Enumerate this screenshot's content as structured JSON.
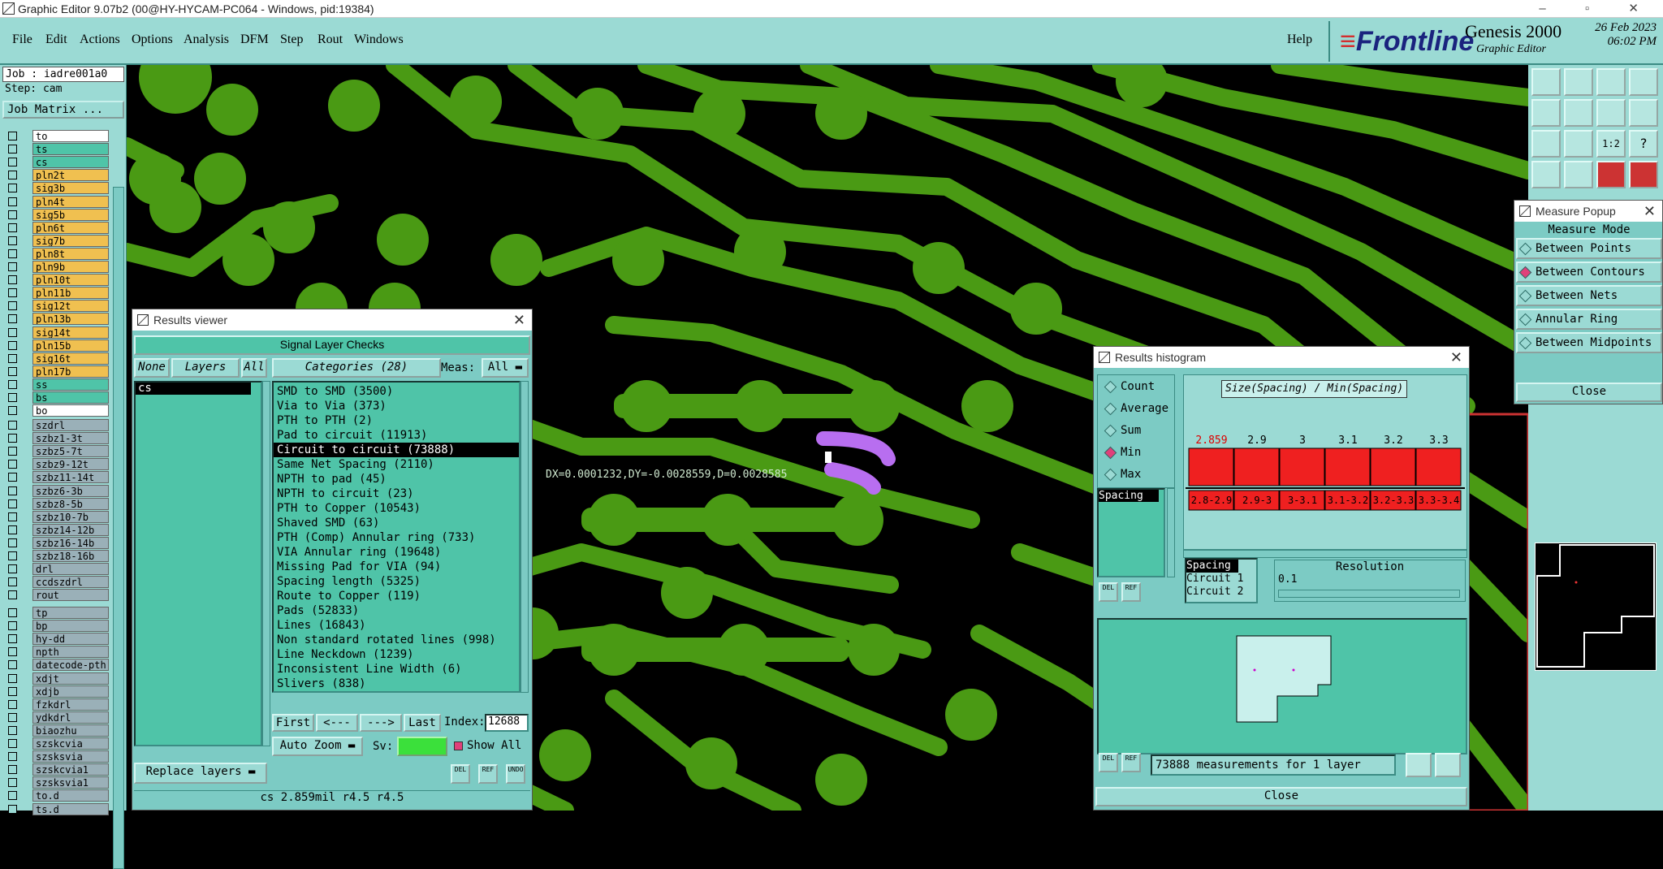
{
  "window": {
    "title": "Graphic Editor 9.07b2 (00@HY-HYCAM-PC064 - Windows, pid:19384)",
    "controls": "– ▫ ✕"
  },
  "menu": [
    "File",
    "Edit",
    "Actions",
    "Options",
    "Analysis",
    "DFM",
    "Step",
    "Rout",
    "Windows"
  ],
  "help": "Help",
  "brand": {
    "logo": "Frontline",
    "product": "Genesis 2000",
    "subtitle": "Graphic Editor",
    "date": "26 Feb 2023",
    "time": "06:02 PM"
  },
  "job": {
    "job_label": "Job : iadre001a0",
    "step_label": "Step: cam",
    "matrix_button": "Job Matrix ..."
  },
  "layers_group1": [
    {
      "name": "to",
      "color": "white"
    },
    {
      "name": "ts",
      "color": "teal"
    },
    {
      "name": "cs",
      "color": "teal"
    },
    {
      "name": "pln2t",
      "color": "orange"
    },
    {
      "name": "sig3b",
      "color": "orange"
    },
    {
      "name": "pln4t",
      "color": "orange"
    },
    {
      "name": "sig5b",
      "color": "orange"
    },
    {
      "name": "pln6t",
      "color": "orange"
    },
    {
      "name": "sig7b",
      "color": "orange"
    },
    {
      "name": "pln8t",
      "color": "orange"
    },
    {
      "name": "pln9b",
      "color": "orange"
    },
    {
      "name": "pln10t",
      "color": "orange"
    },
    {
      "name": "pln11b",
      "color": "orange"
    },
    {
      "name": "sig12t",
      "color": "orange"
    },
    {
      "name": "pln13b",
      "color": "orange"
    },
    {
      "name": "sig14t",
      "color": "orange"
    },
    {
      "name": "pln15b",
      "color": "orange"
    },
    {
      "name": "sig16t",
      "color": "orange"
    },
    {
      "name": "pln17b",
      "color": "orange"
    },
    {
      "name": "ss",
      "color": "teal"
    },
    {
      "name": "bs",
      "color": "teal"
    },
    {
      "name": "bo",
      "color": "white"
    }
  ],
  "layers_group2": [
    {
      "name": "szdrl"
    },
    {
      "name": "szbz1-3t"
    },
    {
      "name": "szbz5-7t"
    },
    {
      "name": "szbz9-12t"
    },
    {
      "name": "szbz11-14t"
    },
    {
      "name": "szbz6-3b"
    },
    {
      "name": "szbz8-5b"
    },
    {
      "name": "szbz10-7b"
    },
    {
      "name": "szbz14-12b"
    },
    {
      "name": "szbz16-14b"
    },
    {
      "name": "szbz18-16b"
    },
    {
      "name": "drl"
    },
    {
      "name": "ccdszdrl"
    },
    {
      "name": "rout"
    }
  ],
  "layers_group3": [
    {
      "name": "tp"
    },
    {
      "name": "bp"
    },
    {
      "name": "hy-dd"
    },
    {
      "name": "npth"
    },
    {
      "name": "datecode-pth"
    },
    {
      "name": "xdjt"
    },
    {
      "name": "xdjb"
    },
    {
      "name": "fzkdrl"
    },
    {
      "name": "ydkdrl"
    },
    {
      "name": "biaozhu"
    },
    {
      "name": "szskcvia"
    },
    {
      "name": "szsksvia"
    },
    {
      "name": "szskcvia1"
    },
    {
      "name": "szsksvia1"
    },
    {
      "name": "to.d"
    },
    {
      "name": "ts.d"
    }
  ],
  "measure_overlay": "DX=0.0001232,DY=-0.0028559,D=0.0028585",
  "results_viewer": {
    "title": "Results viewer",
    "header": "Signal Layer Checks",
    "none_btn": "None",
    "layers_btn": "Layers",
    "all_btn": "All",
    "layer_selected": "cs",
    "categories_btn": "Categories (28)",
    "meas_label": "Meas:",
    "meas_value": "All",
    "categories": [
      "SMD to SMD (3500)",
      "Via to Via (373)",
      "PTH to PTH (2)",
      "Pad to circuit (11913)",
      "Circuit to circuit (73888)",
      "Same Net Spacing (2110)",
      "NPTH to pad (45)",
      "NPTH to circuit (23)",
      "PTH to Copper (10543)",
      "Shaved SMD (63)",
      "PTH (Comp) Annular ring (733)",
      "VIA Annular ring (19648)",
      "Missing Pad for VIA (94)",
      "Spacing length (5325)",
      "Route to Copper (119)",
      "Pads (52833)",
      "Lines (16843)",
      "Non standard rotated lines (998)",
      "Line Neckdown (1239)",
      "Inconsistent Line Width (6)",
      "Slivers (838)"
    ],
    "selected_index": 4,
    "first_btn": "First",
    "prev_btn": "<---",
    "next_btn": "--->",
    "last_btn": "Last",
    "index_label": "Index:",
    "index_value": "12688",
    "auto_zoom": "Auto Zoom",
    "sv_label": "Sv:",
    "show_all": "Show All",
    "replace_layers": "Replace layers",
    "status": "cs 2.859mil  r4.5  r4.5",
    "del_btn": "DEL",
    "ref_btn": "REF",
    "undo_btn": "UNDO"
  },
  "histogram": {
    "title": "Results histogram",
    "modes": [
      "Count",
      "Average",
      "Sum",
      "Min",
      "Max"
    ],
    "selected_mode": "Min",
    "chart_title": "Size(Spacing) / Min(Spacing)",
    "spacing_label": "Spacing",
    "chart_data": {
      "type": "bar",
      "categories": [
        "2.8-2.9",
        "2.9-3",
        "3-3.1",
        "3.1-3.2",
        "3.2-3.3",
        "3.3-3.4"
      ],
      "values": [
        2.859,
        2.9,
        3,
        3.1,
        3.2,
        3.3
      ],
      "value_labels": [
        "2.859",
        "2.9",
        "3",
        "3.1",
        "3.2",
        "3.3"
      ],
      "bar_color": "#ef2020"
    },
    "list_items": [
      "Spacing",
      "Circuit 1",
      "Circuit 2"
    ],
    "resolution_label": "Resolution",
    "resolution_value": "0.1",
    "summary": "73888 measurements for 1 layer",
    "close": "Close",
    "del_btn": "DEL",
    "ref_btn": "REF"
  },
  "measure_popup": {
    "title": "Measure Popup",
    "header": "Measure Mode",
    "modes": [
      "Between Points",
      "Between Contours",
      "Between Nets",
      "Annular Ring",
      "Between Midpoints"
    ],
    "selected": "Between Contours",
    "close": "Close"
  }
}
